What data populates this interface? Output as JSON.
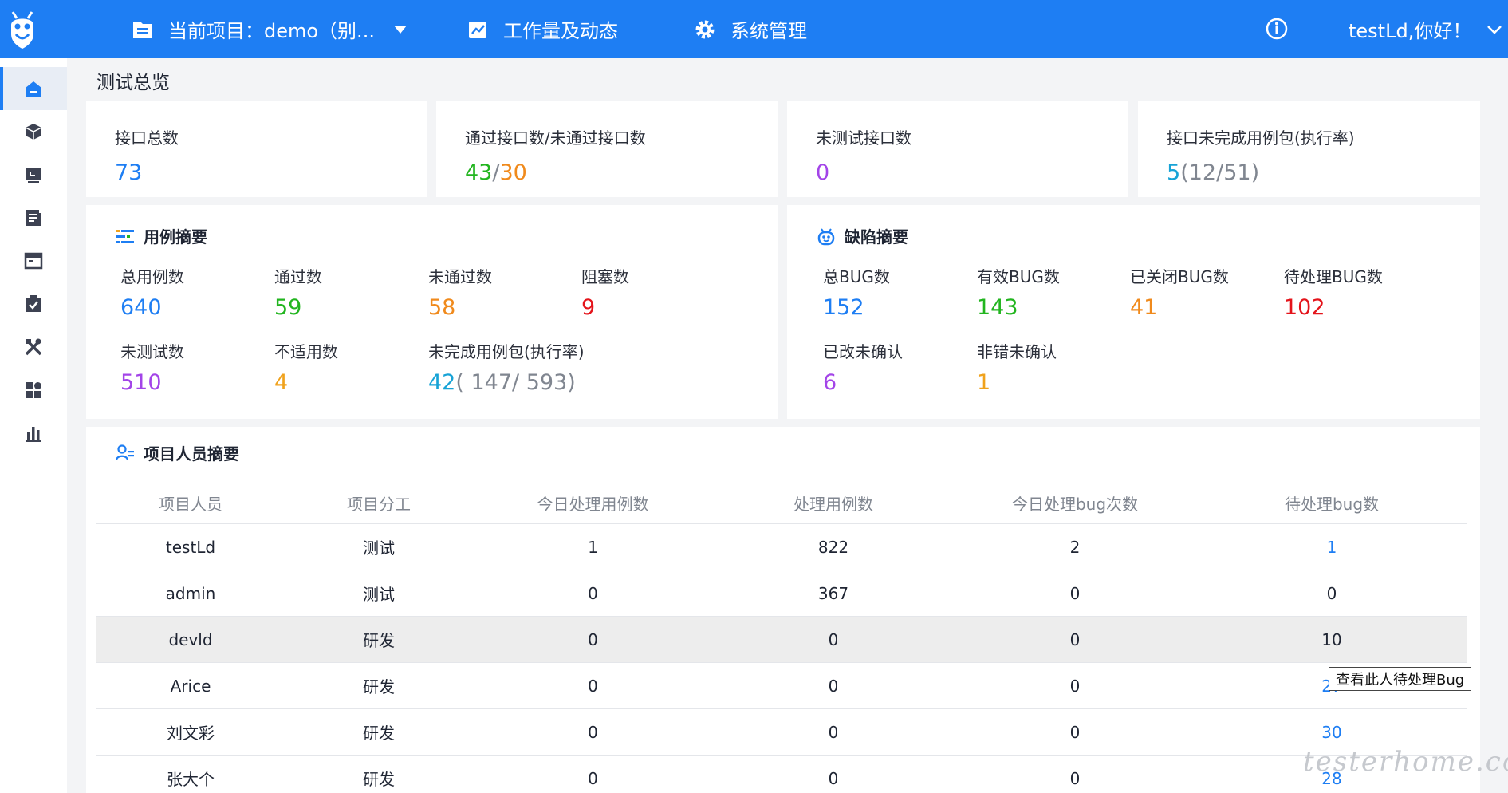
{
  "header": {
    "project_label": "当前项目：demo（别...",
    "work_label": "工作量及动态",
    "system_label": "系统管理",
    "user_greeting": "testLd,你好！",
    "icons": [
      "logo-bug-icon",
      "project-list-icon",
      "chart-icon",
      "gear-icon",
      "help-icon",
      "chevron-down-icon"
    ]
  },
  "sidebar": {
    "items": [
      {
        "icon": "home-icon",
        "active": true
      },
      {
        "icon": "cube-icon"
      },
      {
        "icon": "monitor-icon"
      },
      {
        "icon": "document-icon"
      },
      {
        "icon": "window-icon"
      },
      {
        "icon": "clipboard-check-icon"
      },
      {
        "icon": "tools-icon"
      },
      {
        "icon": "dashboard-grid-icon"
      },
      {
        "icon": "bar-chart-icon"
      }
    ]
  },
  "page_title": "测试总览",
  "stats": {
    "total_api": {
      "label": "接口总数",
      "value": "73"
    },
    "pass_fail_api": {
      "label": "通过接口数/未通过接口数",
      "pass": "43",
      "sep": "/",
      "fail": "30"
    },
    "untested_api": {
      "label": "未测试接口数",
      "value": "0"
    },
    "unfinished_pkg": {
      "label": "接口未完成用例包(执行率)",
      "count": "5",
      "open": "(",
      "done": "12",
      "sep": "/",
      "total": "51",
      "close": ")"
    }
  },
  "case_summary": {
    "title": "用例摘要",
    "total": {
      "label": "总用例数",
      "value": "640"
    },
    "passed": {
      "label": "通过数",
      "value": "59"
    },
    "failed": {
      "label": "未通过数",
      "value": "58"
    },
    "blocked": {
      "label": "阻塞数",
      "value": "9"
    },
    "untested": {
      "label": "未测试数",
      "value": "510"
    },
    "not_applicable": {
      "label": "不适用数",
      "value": "4"
    },
    "unfinished": {
      "label": "未完成用例包(执行率)",
      "count": "42",
      "open": "(",
      "done": " 147",
      "sep": "/",
      "total": " 593",
      "close": ")"
    }
  },
  "bug_summary": {
    "title": "缺陷摘要",
    "total": {
      "label": "总BUG数",
      "value": "152"
    },
    "valid": {
      "label": "有效BUG数",
      "value": "143"
    },
    "closed": {
      "label": "已关闭BUG数",
      "value": "41"
    },
    "pending": {
      "label": "待处理BUG数",
      "value": "102"
    },
    "fixed_unconfirmed": {
      "label": "已改未确认",
      "value": "6"
    },
    "notbug_unconfirmed": {
      "label": "非错未确认",
      "value": "1"
    }
  },
  "people_summary": {
    "title": "项目人员摘要",
    "columns": [
      "项目人员",
      "项目分工",
      "今日处理用例数",
      "处理用例数",
      "今日处理bug次数",
      "待处理bug数"
    ],
    "rows": [
      [
        "testLd",
        "测试",
        "1",
        "822",
        "2",
        "1"
      ],
      [
        "admin",
        "测试",
        "0",
        "367",
        "0",
        "0"
      ],
      [
        "devld",
        "研发",
        "0",
        "0",
        "0",
        "10"
      ],
      [
        "Arice",
        "研发",
        "0",
        "0",
        "0",
        "27"
      ],
      [
        "刘文彩",
        "研发",
        "0",
        "0",
        "0",
        "30"
      ],
      [
        "张大个",
        "研发",
        "0",
        "0",
        "0",
        "28"
      ]
    ],
    "tooltip": "查看此人待处理Bug"
  },
  "watermark": "testerhome.com"
}
